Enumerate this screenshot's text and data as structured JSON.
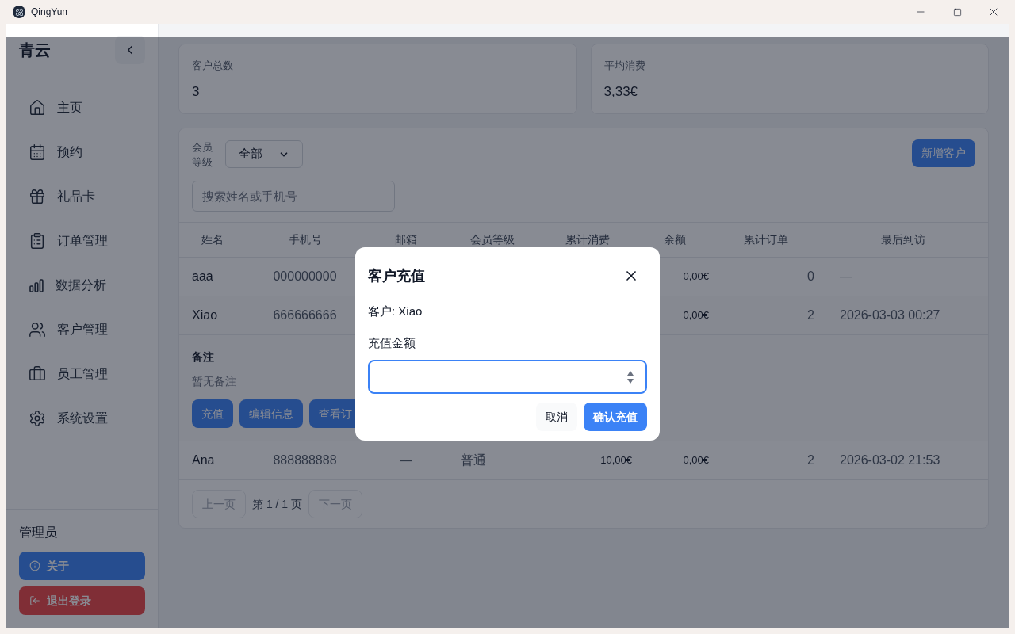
{
  "window": {
    "title": "QingYun"
  },
  "sidebar": {
    "brand": "青云",
    "items": [
      {
        "label": "主页"
      },
      {
        "label": "预约"
      },
      {
        "label": "礼品卡"
      },
      {
        "label": "订单管理"
      },
      {
        "label": "数据分析"
      },
      {
        "label": "客户管理"
      },
      {
        "label": "员工管理"
      },
      {
        "label": "系统设置"
      }
    ],
    "user": "管理员",
    "about_button": "关于",
    "logout_button": "退出登录"
  },
  "stats": [
    {
      "label": "客户总数",
      "value": "3"
    },
    {
      "label": "平均消费",
      "value": "3,33€"
    }
  ],
  "filter": {
    "label": "会员等级",
    "value": "全部",
    "search_placeholder": "搜索姓名或手机号",
    "add_button": "新增客户"
  },
  "table": {
    "columns": [
      "姓名",
      "手机号",
      "邮箱",
      "会员等级",
      "累计消费",
      "余额",
      "累计订单",
      "最后到访"
    ],
    "rows": [
      {
        "name": "aaa",
        "phone": "000000000",
        "balance": "0,00€",
        "orders": "0",
        "last_visit": "—",
        "expanded": false
      },
      {
        "name": "Xiao",
        "phone": "666666666",
        "balance": "0,00€",
        "orders": "2",
        "last_visit": "2026-03-03 00:27",
        "expanded": true,
        "note_title": "备注",
        "note": "暂无备注",
        "actions": [
          "充值",
          "编辑信息",
          "查看订"
        ]
      },
      {
        "name": "Ana",
        "phone": "888888888",
        "email": "—",
        "level": "普通",
        "spent": "10,00€",
        "balance": "0,00€",
        "orders": "2",
        "last_visit": "2026-03-02 21:53",
        "expanded": false
      }
    ]
  },
  "pagination": {
    "prev": {
      "label": "上一页",
      "disabled": true
    },
    "page": "第 1 / 1 页",
    "next": {
      "label": "下一页",
      "disabled": true
    }
  },
  "dialog": {
    "title": "客户充值",
    "customer": "客户: Xiao",
    "field_label": "充值金额",
    "cancel": "取消",
    "confirm": "确认充值"
  }
}
